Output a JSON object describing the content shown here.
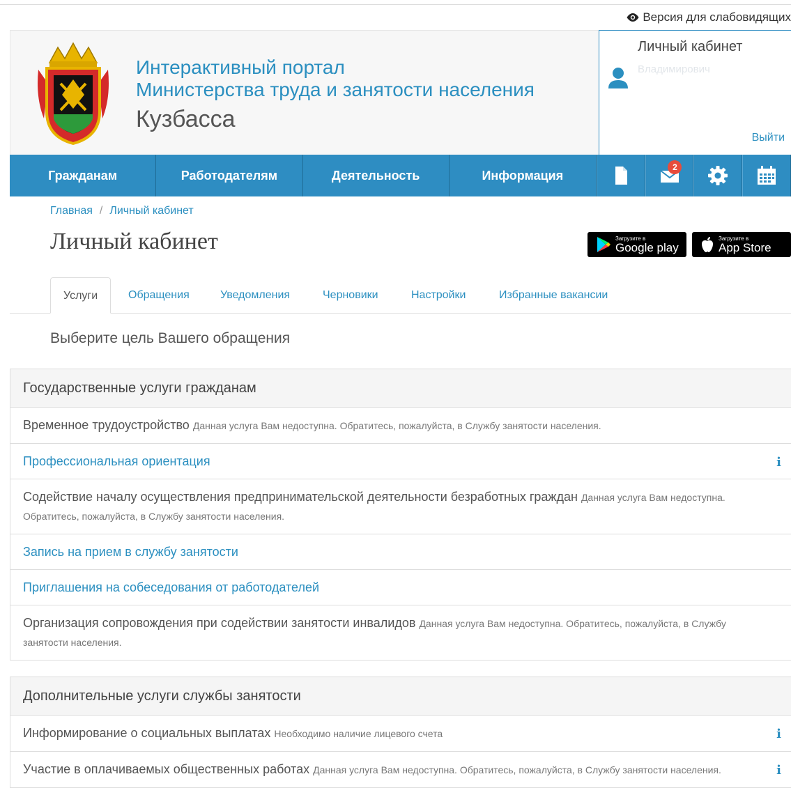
{
  "accessibility": {
    "low_vision_label": "Версия для слабовидящих"
  },
  "header": {
    "title_line1": "Интерактивный портал",
    "title_line2": "Министерства труда и занятости населения",
    "region": "Кузбасса"
  },
  "cabinet_box": {
    "title": "Личный кабинет",
    "user_name_line1": "",
    "user_name_line2": "",
    "user_name_line3": "Владимирович",
    "logout": "Выйти"
  },
  "nav": {
    "items": [
      {
        "label": "Гражданам"
      },
      {
        "label": "Работодателям"
      },
      {
        "label": "Деятельность"
      },
      {
        "label": "Информация"
      }
    ],
    "icons": [
      "document-icon",
      "mail-icon",
      "gear-icon",
      "calendar-icon"
    ],
    "mail_badge": "2"
  },
  "breadcrumb": {
    "home": "Главная",
    "separator": "/",
    "current": "Личный кабинет"
  },
  "page_title": "Личный кабинет",
  "stores": {
    "google": {
      "small": "Загрузите в",
      "big": "Google play"
    },
    "apple": {
      "small": "Загрузите в",
      "big": "App Store"
    }
  },
  "tabs": [
    {
      "label": "Услуги",
      "active": true
    },
    {
      "label": "Обращения"
    },
    {
      "label": "Уведомления"
    },
    {
      "label": "Черновики"
    },
    {
      "label": "Настройки"
    },
    {
      "label": "Избранные вакансии"
    }
  ],
  "prompt": "Выберите цель Вашего обращения",
  "sections": [
    {
      "title": "Государственные услуги гражданам",
      "rows": [
        {
          "title": "Временное трудоустройство",
          "note": "Данная услуга Вам недоступна. Обратитесь, пожалуйста, в Службу занятости населения."
        },
        {
          "title": "Профессиональная ориентация",
          "note": "",
          "info": "i"
        },
        {
          "title": "Содействие началу осуществления предпринимательской деятельности безработных граждан",
          "note": "Данная услуга Вам недоступна. Обратитесь, пожалуйста, в Службу занятости населения."
        },
        {
          "title": "Запись на прием в службу занятости",
          "note": ""
        },
        {
          "title": "Приглашения на собеседования от работодателей",
          "note": ""
        },
        {
          "title": "Организация сопровождения при содействии занятости инвалидов",
          "note": "Данная услуга Вам недоступна. Обратитесь, пожалуйста, в Службу занятости населения."
        }
      ]
    },
    {
      "title": "Дополнительные услуги службы занятости",
      "rows": [
        {
          "title": "Информирование о социальных выплатах",
          "note": "Необходимо наличие лицевого счета",
          "info": "i"
        },
        {
          "title": "Участие в оплачиваемых общественных работах",
          "note": "Данная услуга Вам недоступна. Обратитесь, пожалуйста, в Службу занятости населения.",
          "info": "i"
        }
      ]
    }
  ],
  "colors": {
    "brand_blue": "#2e8dc2",
    "link_blue": "#2b8fc0",
    "badge_red": "#e74c3c"
  }
}
